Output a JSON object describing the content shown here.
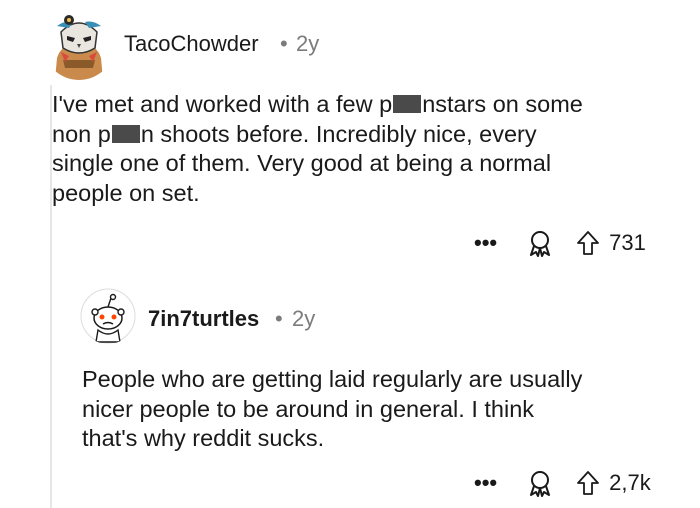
{
  "comments": [
    {
      "username": "TacoChowder",
      "separator": "•",
      "age": "2y",
      "body_parts": [
        "I've met and worked with a few p",
        "nstars on some",
        "non p",
        "n shoots before. Incredibly nice, every",
        "single one of them. Very good at being a normal",
        "people on set."
      ],
      "votes": "731",
      "more_label": "•••",
      "icons": {
        "more": "more-options-icon",
        "award": "award-icon",
        "upvote": "upvote-arrow-icon"
      }
    },
    {
      "username": "7in7turtles",
      "separator": "•",
      "age": "2y",
      "body_lines": [
        "People who are getting laid regularly are usually",
        "nicer people to be around in general. I think",
        "that's why reddit sucks."
      ],
      "votes": "2,7k",
      "more_label": "•••",
      "icons": {
        "more": "more-options-icon",
        "award": "award-icon",
        "upvote": "upvote-arrow-icon"
      }
    }
  ],
  "colors": {
    "text": "#1a1a1b",
    "meta": "#7c7c7c",
    "thread_line": "#e4e6e8",
    "snoo_red": "#ff4500"
  }
}
